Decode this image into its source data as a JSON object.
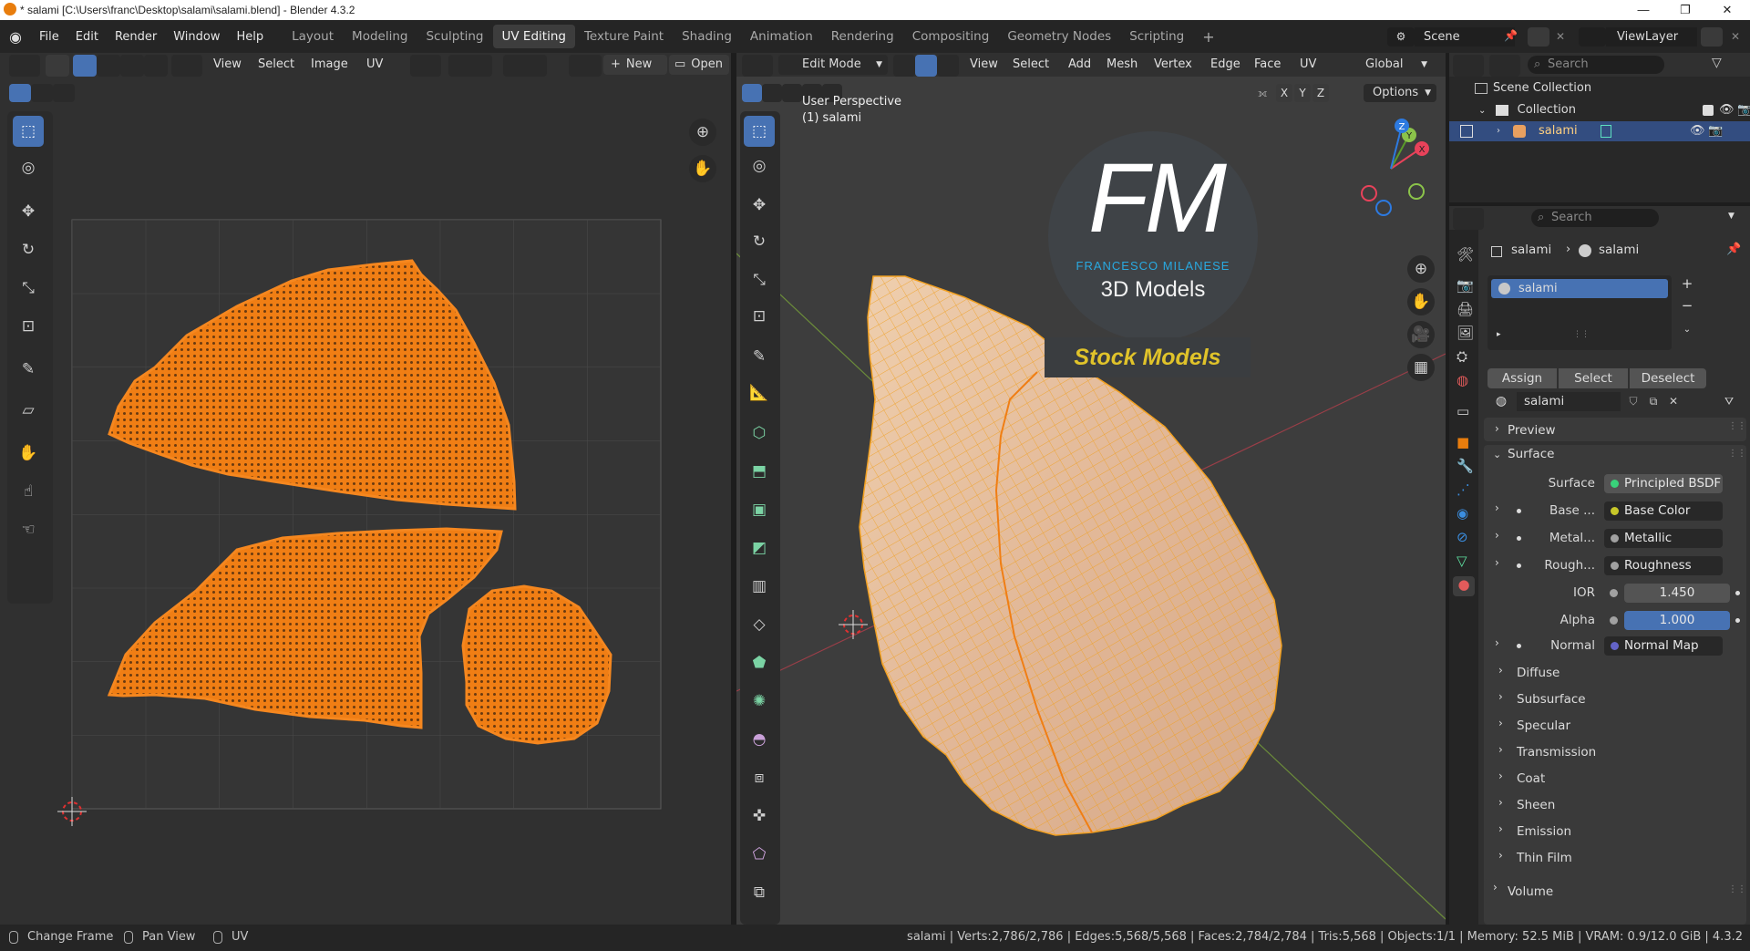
{
  "window": {
    "title": "* salami [C:\\Users\\franc\\Desktop\\salami\\salami.blend] - Blender 4.3.2",
    "minimize": "—",
    "maximize": "❐",
    "close": "✕"
  },
  "menu": [
    "File",
    "Edit",
    "Render",
    "Window",
    "Help"
  ],
  "workspaces": [
    "Layout",
    "Modeling",
    "Sculpting",
    "UV Editing",
    "Texture Paint",
    "Shading",
    "Animation",
    "Rendering",
    "Compositing",
    "Geometry Nodes",
    "Scripting"
  ],
  "active_workspace": "UV Editing",
  "scene": {
    "label": "Scene",
    "view_layer": "ViewLayer"
  },
  "uv_editor": {
    "menus": [
      "View",
      "Select",
      "Image",
      "UV"
    ],
    "new_label": "New",
    "open_label": "Open"
  },
  "viewport": {
    "mode": "Edit Mode",
    "menus": [
      "View",
      "Select",
      "Add",
      "Mesh",
      "Vertex",
      "Edge",
      "Face",
      "UV"
    ],
    "transform": "Global",
    "options_label": "Options",
    "axes": [
      "X",
      "Y",
      "Z"
    ],
    "perspective": "User Perspective",
    "object_info": "(1) salami",
    "gizmo_labels": [
      "X",
      "Y",
      "Z"
    ]
  },
  "watermark": {
    "logo": "FM",
    "name": "FRANCESCO MILANESE",
    "subtitle": "3D Models",
    "banner": "Stock Models"
  },
  "outliner": {
    "search_placeholder": "Search",
    "scene_collection": "Scene Collection",
    "collection": "Collection",
    "object": "salami"
  },
  "properties": {
    "search_placeholder": "Search",
    "breadcrumb_object": "salami",
    "breadcrumb_material": "salami",
    "slot_name": "salami",
    "assign_label": "Assign",
    "select_label": "Select",
    "deselect_label": "Deselect",
    "material_name": "salami",
    "preview_label": "Preview",
    "surface_label": "Surface",
    "surface_field_label": "Surface",
    "surface_shader": "Principled BSDF",
    "inputs": [
      {
        "label": "Base ...",
        "value": "Base Color",
        "dot": "#c7c729"
      },
      {
        "label": "Metal...",
        "value": "Metallic",
        "dot": "#a1a1a1"
      },
      {
        "label": "Rough...",
        "value": "Roughness",
        "dot": "#a1a1a1"
      }
    ],
    "ior_label": "IOR",
    "ior_value": "1.450",
    "alpha_label": "Alpha",
    "alpha_value": "1.000",
    "normal_label": "Normal",
    "normal_value": "Normal Map",
    "subsections": [
      "Diffuse",
      "Subsurface",
      "Specular",
      "Transmission",
      "Coat",
      "Sheen",
      "Emission",
      "Thin Film"
    ],
    "volume_label": "Volume"
  },
  "status": {
    "hint1": "Change Frame",
    "hint2": "Pan View",
    "hint3": "UV",
    "stats": "salami | Verts:2,786/2,786 | Edges:5,568/5,568 | Faces:2,784/2,784 | Tris:5,568 | Objects:1/1 | Memory: 52.5 MiB | VRAM: 0.9/12.0 GiB | 4.3.2"
  },
  "colors": {
    "accent": "#4772b3",
    "uv_orange": "#f5871f",
    "edit_wire": "#f0a020",
    "mesh_surface": "#e4bfa0"
  }
}
